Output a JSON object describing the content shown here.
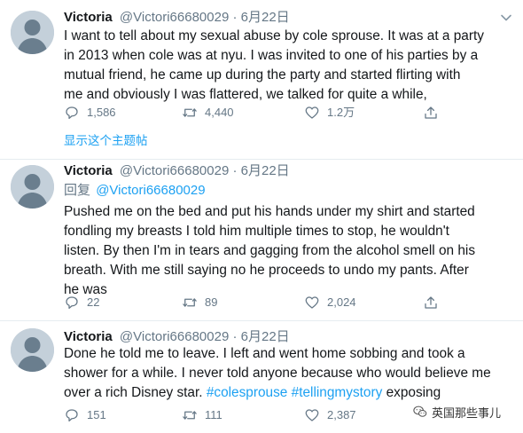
{
  "tweets": [
    {
      "name": "Victoria",
      "handle": "@Victori66680029",
      "separator": "·",
      "date": "6月22日",
      "reply_prefix": "",
      "reply_mention": "",
      "lines": [
        "I want to tell about my sexual abuse by cole sprouse. It was at a party",
        "in 2013 when cole was at nyu.  I was invited to one of his parties by a",
        "mutual friend, he came up during the party and started flirting with",
        "me and obviously I was flattered, we talked for quite a while,"
      ],
      "replies": "1,586",
      "retweets": "4,440",
      "likes": "1.2万",
      "show_thread": "显示这个主题帖"
    },
    {
      "name": "Victoria",
      "handle": "@Victori66680029",
      "separator": "·",
      "date": "6月22日",
      "reply_prefix": "回复",
      "reply_mention": "@Victori66680029",
      "lines": [
        "Pushed me on the bed and put his hands under my shirt and started",
        "fondling my breasts I told him multiple times to stop, he wouldn't",
        "listen.  By then I'm in tears and gagging from the alcohol smell on his",
        "breath. With me still saying no he proceeds to undo my pants. After",
        "he was"
      ],
      "replies": "22",
      "retweets": "89",
      "likes": "2,024"
    },
    {
      "name": "Victoria",
      "handle": "@Victori66680029",
      "separator": "·",
      "date": "6月22日",
      "lines": [
        "Done he told me to leave.  I left and went home sobbing and took a",
        "shower for a while. I never told anyone because who would believe me"
      ],
      "line3_pre": "over a rich Disney star. ",
      "hashtag1": "#colesprouse",
      "line3_mid": " ",
      "hashtag2": "#tellingmystory",
      "line3_post": " exposing",
      "replies": "151",
      "retweets": "111",
      "likes": "2,387"
    }
  ],
  "watermark": "英国那些事儿",
  "icons": {
    "reply": "reply-bubble-icon",
    "retweet": "retweet-arrows-icon",
    "like": "heart-icon",
    "share": "share-upload-icon",
    "more": "chevron-down-icon",
    "avatar": "default-avatar-icon",
    "watermark": "wechat-logo-icon"
  },
  "colors": {
    "link": "#1da1f2",
    "muted": "#657786",
    "text": "#14171a",
    "avatar_bg": "#c4d0da",
    "divider": "#e6ecf0"
  }
}
